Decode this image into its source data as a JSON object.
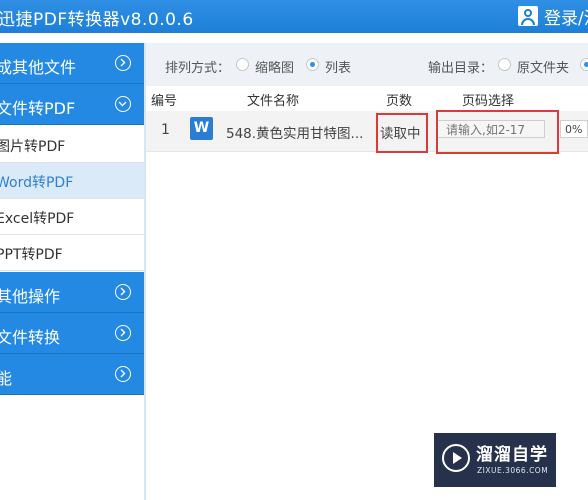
{
  "app": {
    "title": "迅捷PDF转换器v8.0.0.6",
    "login_label": "登录/注"
  },
  "sidebar": {
    "groups": [
      {
        "label": "成其他文件",
        "expanded": false
      },
      {
        "label": "文件转PDF",
        "expanded": true
      },
      {
        "label": "其他操作",
        "expanded": false
      },
      {
        "label": "文件转换",
        "expanded": false
      },
      {
        "label": "能",
        "expanded": false
      }
    ],
    "sub_items": [
      {
        "label": "图片转PDF",
        "active": false
      },
      {
        "label": "Word转PDF",
        "active": true
      },
      {
        "label": "Excel转PDF",
        "active": false
      },
      {
        "label": "PPT转PDF",
        "active": false
      }
    ]
  },
  "toolbar": {
    "sort_label": "排列方式：",
    "sort_options": [
      {
        "label": "缩略图",
        "selected": false
      },
      {
        "label": "列表",
        "selected": true
      }
    ],
    "output_label": "输出目录：",
    "output_options": [
      {
        "label": "原文件夹",
        "selected": false
      }
    ]
  },
  "table": {
    "headers": [
      "编号",
      "文件名称",
      "页数",
      "页码选择"
    ],
    "rows": [
      {
        "index": "1",
        "icon": "W",
        "filename": "548.黄色实用甘特图...",
        "pages": "读取中",
        "page_select_placeholder": "请输入,如2-17",
        "progress": "0%"
      }
    ]
  },
  "watermark": {
    "name": "溜溜自学",
    "url": "ZIXUE.3066.COM"
  },
  "colors": {
    "brand_blue": "#2389e3",
    "active_sub_bg": "#dbeaf8",
    "highlight_red": "#d93b3b"
  }
}
